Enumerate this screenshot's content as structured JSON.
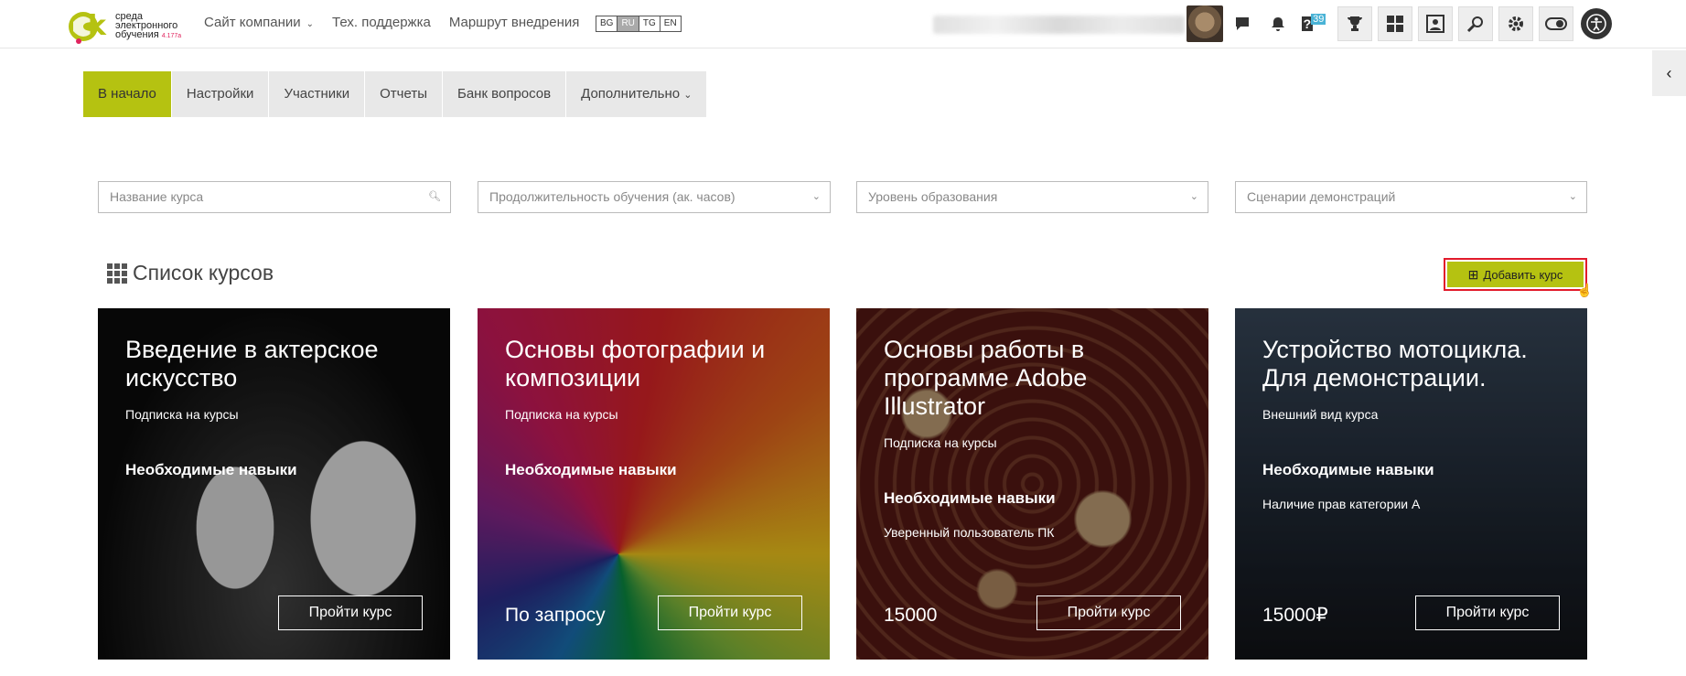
{
  "logo": {
    "mark": "3k",
    "line1": "среда",
    "line2": "электронного",
    "line3": "обучения",
    "version": "4.177a"
  },
  "topnav": {
    "items": [
      {
        "label": "Сайт компании",
        "dropdown": true
      },
      {
        "label": "Тех. поддержка"
      },
      {
        "label": "Маршрут внедрения"
      }
    ],
    "languages": [
      "BG",
      "RU",
      "TG",
      "EN"
    ],
    "active_language": "RU"
  },
  "toolbar": {
    "question_badge": "?",
    "question_count": "39"
  },
  "menu": {
    "items": [
      "В начало",
      "Настройки",
      "Участники",
      "Отчеты",
      "Банк вопросов",
      "Дополнительно"
    ],
    "active": "В начало"
  },
  "filters": {
    "search_placeholder": "Название курса",
    "duration": "Продолжительность обучения (ак. часов)",
    "level": "Уровень образования",
    "scenario": "Сценарии демонстраций"
  },
  "courses_heading": "Список курсов",
  "add_course_label": "Добавить курс",
  "courses": [
    {
      "title": "Введение в актерское искусство",
      "subtitle": "Подписка на курсы",
      "skills_label": "Необходимые навыки",
      "requirement": "",
      "price": "",
      "button": "Пройти курс"
    },
    {
      "title": "Основы фотографии и композиции",
      "subtitle": "Подписка на курсы",
      "skills_label": "Необходимые навыки",
      "requirement": "",
      "price": "По запросу",
      "button": "Пройти курс"
    },
    {
      "title": "Основы работы в программе Adobe Illustrator",
      "subtitle": "Подписка на курсы",
      "skills_label": "Необходимые навыки",
      "requirement": "Уверенный пользователь ПК",
      "price": "15000",
      "button": "Пройти курс"
    },
    {
      "title": "Устройство мотоцикла. Для демонстрации.",
      "subtitle": "Внешний вид курса",
      "skills_label": "Необходимые навыки",
      "requirement": "Наличие прав категории А",
      "price": "15000₽",
      "button": "Пройти курс"
    }
  ],
  "colors": {
    "accent": "#b5c211",
    "highlight_border": "#e21b2b",
    "menu_bg": "#e8e8e8"
  }
}
